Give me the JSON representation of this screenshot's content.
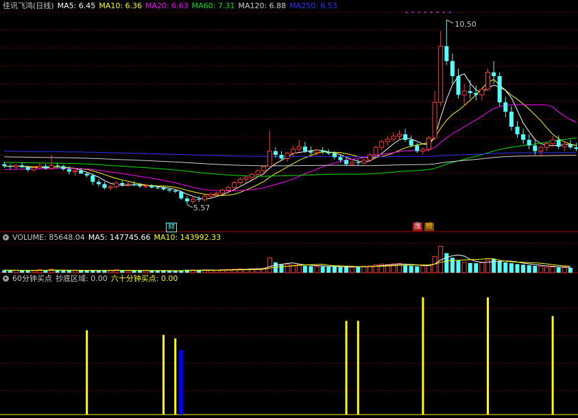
{
  "colors": {
    "up": "#ff3c3c",
    "down": "#54fcfc",
    "ma5": "#ffffff",
    "ma10": "#ffff00",
    "ma20": "#ff00ff",
    "ma60": "#00e600",
    "ma120": "#d0d0d0",
    "ma250": "#3030ff",
    "grid": "#7a0000",
    "divider": "#b00000",
    "bar_yellow": "#ffff00",
    "bar_blue": "#0000ff"
  },
  "price_header": {
    "title": "佳讯飞鸿(日线)",
    "ma5": "MA5: 6.45",
    "ma10": "MA10: 6.36",
    "ma20": "MA20: 6.63",
    "ma60": "MA60: 7.31",
    "ma120": "MA120: 6.88",
    "ma250": "MA250: 6.53"
  },
  "volume_header": {
    "label": "VOLUME: 85648.04",
    "ma5": "MA5: 147745.66",
    "ma10": "MA10: 143992.33"
  },
  "indicator_header": {
    "label": "60分钟买点",
    "bottom": "抄底区域: 0.00",
    "sixty": "六十分钟买点: 0.00"
  },
  "markers": {
    "high_label": "10.50",
    "low_label": "5.57",
    "low_tag": "财",
    "tag1": "涨",
    "tag2": "榜"
  },
  "chart_data": [
    {
      "type": "candlestick",
      "title": "佳讯飞鸿(日线)",
      "ylim": [
        5.0,
        10.7
      ],
      "high": 10.5,
      "low": 5.57,
      "candles": [
        [
          6.65,
          6.72,
          6.55,
          6.6
        ],
        [
          6.6,
          6.66,
          6.52,
          6.58
        ],
        [
          6.58,
          6.65,
          6.5,
          6.62
        ],
        [
          6.62,
          6.7,
          6.55,
          6.57
        ],
        [
          6.57,
          6.62,
          6.45,
          6.5
        ],
        [
          6.5,
          6.6,
          6.46,
          6.56
        ],
        [
          6.56,
          6.7,
          6.52,
          6.6
        ],
        [
          6.6,
          6.65,
          6.5,
          6.54
        ],
        [
          6.54,
          6.9,
          6.5,
          6.62
        ],
        [
          6.62,
          6.68,
          6.55,
          6.6
        ],
        [
          6.6,
          6.64,
          6.48,
          6.52
        ],
        [
          6.52,
          6.6,
          6.38,
          6.45
        ],
        [
          6.45,
          6.5,
          6.35,
          6.48
        ],
        [
          6.48,
          6.55,
          6.42,
          6.4
        ],
        [
          6.4,
          6.45,
          6.3,
          6.35
        ],
        [
          6.35,
          6.4,
          6.1,
          6.18
        ],
        [
          6.18,
          6.25,
          6.05,
          6.12
        ],
        [
          6.12,
          6.18,
          5.98,
          6.02
        ],
        [
          6.02,
          6.1,
          5.95,
          6.05
        ],
        [
          6.05,
          6.2,
          6.0,
          6.15
        ],
        [
          6.15,
          6.22,
          6.05,
          6.1
        ],
        [
          6.1,
          6.18,
          6.04,
          6.12
        ],
        [
          6.12,
          6.2,
          6.06,
          6.09
        ],
        [
          6.09,
          6.15,
          6.02,
          6.06
        ],
        [
          6.06,
          6.12,
          6.0,
          6.08
        ],
        [
          6.08,
          6.12,
          6.0,
          6.03
        ],
        [
          6.03,
          6.08,
          5.98,
          6.02
        ],
        [
          6.02,
          6.06,
          5.95,
          5.98
        ],
        [
          5.98,
          6.02,
          5.9,
          5.95
        ],
        [
          5.95,
          5.98,
          5.88,
          5.92
        ],
        [
          5.92,
          5.95,
          5.7,
          5.74
        ],
        [
          5.74,
          5.8,
          5.57,
          5.66
        ],
        [
          5.66,
          5.78,
          5.6,
          5.72
        ],
        [
          5.72,
          5.8,
          5.65,
          5.7
        ],
        [
          5.7,
          5.84,
          5.66,
          5.8
        ],
        [
          5.8,
          5.9,
          5.75,
          5.85
        ],
        [
          5.85,
          5.92,
          5.8,
          5.88
        ],
        [
          5.88,
          6.0,
          5.84,
          5.96
        ],
        [
          5.96,
          6.08,
          5.9,
          6.03
        ],
        [
          6.03,
          6.2,
          6.0,
          6.16
        ],
        [
          6.16,
          6.3,
          6.1,
          6.25
        ],
        [
          6.25,
          6.35,
          6.15,
          6.3
        ],
        [
          6.3,
          6.42,
          6.22,
          6.38
        ],
        [
          6.38,
          6.5,
          6.3,
          6.48
        ],
        [
          6.48,
          6.62,
          6.42,
          6.58
        ],
        [
          6.6,
          7.55,
          6.6,
          7.0
        ],
        [
          7.0,
          7.1,
          6.82,
          6.9
        ],
        [
          6.9,
          7.0,
          6.75,
          6.8
        ],
        [
          6.8,
          6.98,
          6.72,
          6.95
        ],
        [
          6.95,
          7.15,
          6.85,
          7.05
        ],
        [
          7.05,
          7.3,
          6.98,
          7.12
        ],
        [
          7.12,
          7.25,
          6.95,
          7.0
        ],
        [
          7.0,
          7.12,
          6.9,
          6.96
        ],
        [
          6.96,
          7.05,
          6.88,
          7.02
        ],
        [
          7.02,
          7.1,
          6.92,
          6.98
        ],
        [
          6.98,
          7.05,
          6.9,
          6.94
        ],
        [
          6.94,
          7.0,
          6.78,
          6.84
        ],
        [
          6.84,
          6.92,
          6.7,
          6.76
        ],
        [
          6.76,
          6.82,
          6.6,
          6.65
        ],
        [
          6.65,
          6.75,
          6.58,
          6.7
        ],
        [
          6.7,
          6.78,
          6.62,
          6.68
        ],
        [
          6.68,
          6.8,
          6.64,
          6.76
        ],
        [
          6.76,
          6.95,
          6.72,
          6.9
        ],
        [
          6.9,
          7.15,
          6.85,
          7.1
        ],
        [
          7.1,
          7.3,
          7.02,
          7.25
        ],
        [
          7.25,
          7.4,
          7.15,
          7.32
        ],
        [
          7.32,
          7.5,
          7.25,
          7.4
        ],
        [
          7.4,
          7.55,
          7.3,
          7.45
        ],
        [
          7.45,
          7.6,
          7.25,
          7.3
        ],
        [
          7.3,
          7.42,
          7.1,
          7.15
        ],
        [
          7.15,
          7.22,
          6.95,
          7.0
        ],
        [
          7.0,
          7.1,
          6.92,
          7.05
        ],
        [
          7.05,
          7.4,
          7.0,
          7.35
        ],
        [
          7.35,
          8.6,
          7.3,
          8.3
        ],
        [
          8.3,
          10.2,
          8.2,
          9.8
        ],
        [
          9.8,
          10.5,
          9.3,
          9.4
        ],
        [
          9.4,
          9.6,
          8.8,
          9.0
        ],
        [
          9.0,
          9.2,
          8.4,
          8.5
        ],
        [
          8.5,
          8.8,
          8.2,
          8.6
        ],
        [
          8.6,
          8.9,
          8.4,
          8.55
        ],
        [
          8.55,
          8.75,
          8.35,
          8.5
        ],
        [
          8.5,
          8.7,
          8.35,
          8.65
        ],
        [
          8.65,
          9.2,
          8.6,
          9.1
        ],
        [
          9.1,
          9.4,
          8.8,
          9.0
        ],
        [
          9.0,
          9.1,
          8.2,
          8.3
        ],
        [
          8.3,
          8.45,
          7.9,
          8.05
        ],
        [
          8.05,
          8.2,
          7.55,
          7.65
        ],
        [
          7.65,
          7.8,
          7.35,
          7.45
        ],
        [
          7.45,
          7.6,
          7.2,
          7.3
        ],
        [
          7.3,
          7.45,
          7.05,
          7.15
        ],
        [
          7.15,
          7.3,
          6.9,
          7.0
        ],
        [
          7.0,
          7.15,
          6.85,
          7.1
        ],
        [
          7.1,
          7.25,
          7.0,
          7.2
        ],
        [
          7.2,
          7.4,
          7.1,
          7.3
        ],
        [
          7.3,
          7.42,
          7.05,
          7.12
        ],
        [
          7.12,
          7.25,
          7.0,
          7.18
        ],
        [
          7.18,
          7.3,
          7.05,
          7.1
        ],
        [
          7.1,
          7.22,
          7.0,
          7.06
        ]
      ]
    },
    {
      "type": "bar",
      "ylabel": "VOLUME",
      "ylim": [
        0,
        500000
      ],
      "values": [
        45000,
        40000,
        42000,
        38000,
        44000,
        36000,
        52000,
        40000,
        60000,
        38000,
        35000,
        42000,
        37000,
        40000,
        34000,
        46000,
        40000,
        44000,
        36000,
        50000,
        38000,
        34000,
        42000,
        36000,
        38000,
        34000,
        32000,
        36000,
        30000,
        34000,
        44000,
        52000,
        48000,
        40000,
        50000,
        46000,
        42000,
        54000,
        56000,
        62000,
        66000,
        60000,
        68000,
        72000,
        78000,
        260000,
        180000,
        140000,
        150000,
        130000,
        145000,
        120000,
        115000,
        110000,
        108000,
        102000,
        112000,
        98000,
        104000,
        96000,
        108000,
        112000,
        118000,
        138000,
        150000,
        142000,
        155000,
        160000,
        135000,
        120000,
        112000,
        118000,
        130000,
        280000,
        460000,
        340000,
        260000,
        210000,
        180000,
        170000,
        165000,
        175000,
        220000,
        240000,
        200000,
        180000,
        165000,
        150000,
        140000,
        130000,
        120000,
        110000,
        98000,
        100000,
        92000,
        88000,
        85648
      ]
    },
    {
      "type": "bar",
      "title": "60分钟买点",
      "series": [
        {
          "name": "抄底区域",
          "values": [
            {
              "i": 30,
              "v": 0.55
            }
          ]
        },
        {
          "name": "六十分钟买点",
          "values": [
            {
              "i": 14,
              "v": 0.72
            },
            {
              "i": 27,
              "v": 0.68
            },
            {
              "i": 29,
              "v": 0.65
            },
            {
              "i": 58,
              "v": 0.8
            },
            {
              "i": 60,
              "v": 0.8
            },
            {
              "i": 71,
              "v": 1.0
            },
            {
              "i": 82,
              "v": 1.0
            },
            {
              "i": 93,
              "v": 0.84
            }
          ]
        }
      ]
    }
  ]
}
